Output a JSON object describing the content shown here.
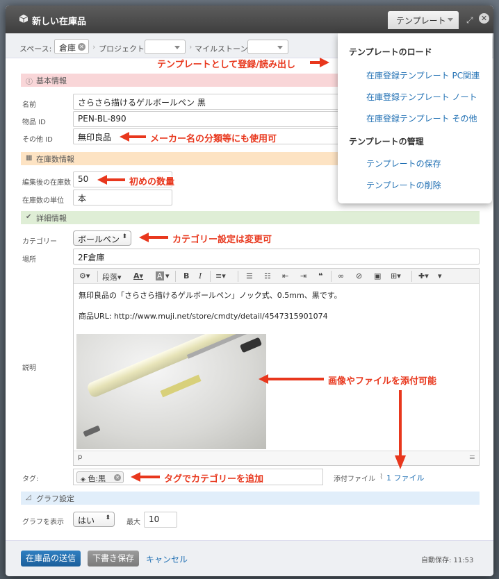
{
  "window": {
    "title": "新しい在庫品"
  },
  "template_button": {
    "label": "テンプレート"
  },
  "filters": {
    "space_label": "スペース:",
    "space_value": "倉庫",
    "project_label": "プロジェクト",
    "milestone_label": "マイルストーン"
  },
  "sections": {
    "basic": "基本情報",
    "stock": "在庫数情報",
    "detail": "詳細情報",
    "graph": "グラフ設定"
  },
  "fields": {
    "name_label": "名前",
    "name_value": "さらさら描けるゲルボールペン 黒",
    "item_id_label": "物品 ID",
    "item_id_value": "PEN-BL-890",
    "other_id_label": "その他 ID",
    "other_id_value": "無印良品",
    "stock_after_label": "編集後の在庫数",
    "stock_after_value": "50",
    "unit_label": "在庫数の単位",
    "unit_value": "本",
    "category_label": "カテゴリー",
    "category_value": "ボールペン",
    "place_label": "場所",
    "place_value": "2F倉庫",
    "description_label": "説明",
    "tags_label": "タグ:",
    "tag_value": "色:黒",
    "attach_label": "添付ファイル",
    "attach_value": "1 ファイル",
    "graph_show_label": "グラフを表示",
    "graph_show_value": "はい",
    "max_label": "最大",
    "max_value": "10"
  },
  "editor": {
    "toolbar_paragraph": "段落",
    "line1": "無印良品の「さらさら描けるゲルボールペン」ノック式、0.5mm、黒です。",
    "line2": "商品URL: http://www.muji.net/store/cmdty/detail/4547315901074",
    "status_path": "p"
  },
  "footer": {
    "submit_label": "在庫品の送信",
    "draft_label": "下書き保存",
    "cancel_label": "キャンセル",
    "autosave": "自動保存: 11:53"
  },
  "template_menu": {
    "load_heading": "テンプレートのロード",
    "items": [
      "在庫登録テンプレート PC関連",
      "在庫登録テンプレート ノート",
      "在庫登録テンプレート その他"
    ],
    "manage_heading": "テンプレートの管理",
    "save_label": "テンプレートの保存",
    "delete_label": "テンプレートの削除"
  },
  "annotations": {
    "template": "テンプレートとして登録/読み出し",
    "maker": "メーカー名の分類等にも使用可",
    "initial_qty": "初めの数量",
    "category": "カテゴリー設定は変更可",
    "attach": "画像やファイルを添付可能",
    "tag": "タグでカテゴリーを追加"
  },
  "colors": {
    "annotation": "#e8371d",
    "primary": "#2f7fc1",
    "link": "#1f6fb3"
  }
}
